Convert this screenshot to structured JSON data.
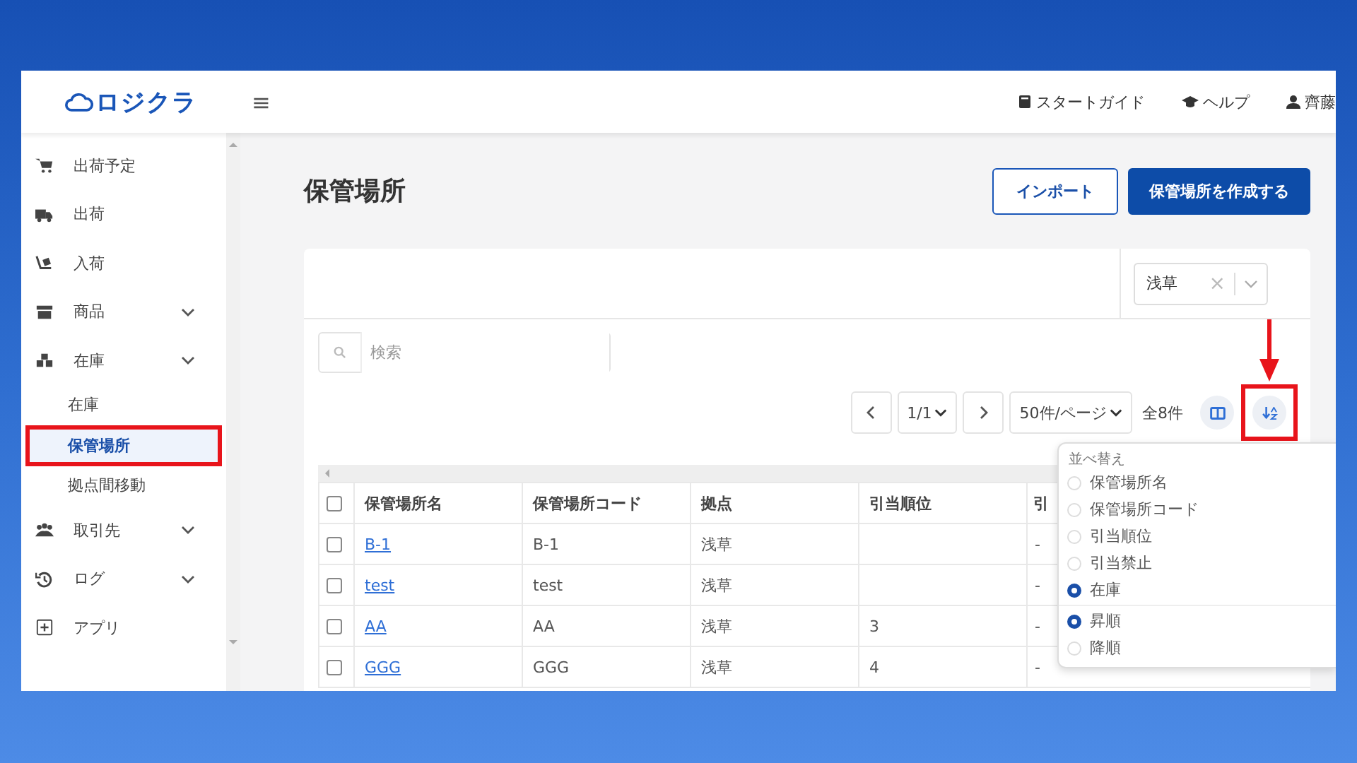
{
  "logo": {
    "text": "ロジクラ"
  },
  "header": {
    "menu_icon": "≡",
    "links": [
      {
        "kind": "book",
        "label": "スタートガイド"
      },
      {
        "kind": "cap",
        "label": "ヘルプ"
      },
      {
        "kind": "user",
        "label": "齊藤"
      }
    ]
  },
  "sidebar": {
    "items": [
      {
        "kind": "cart",
        "label": "出荷予定"
      },
      {
        "kind": "truck",
        "label": "出荷"
      },
      {
        "kind": "dolly",
        "label": "入荷"
      },
      {
        "kind": "box",
        "label": "商品",
        "collapsible": true
      },
      {
        "kind": "boxes",
        "label": "在庫",
        "collapsible": true,
        "children": [
          {
            "label": "在庫",
            "selected": false
          },
          {
            "label": "保管場所",
            "selected": true
          },
          {
            "label": "拠点間移動",
            "selected": false
          }
        ]
      },
      {
        "kind": "people",
        "label": "取引先",
        "collapsible": true
      },
      {
        "kind": "history",
        "label": "ログ",
        "collapsible": true
      },
      {
        "kind": "plus",
        "label": "アプリ"
      }
    ]
  },
  "page": {
    "title": "保管場所",
    "buttons": [
      {
        "kind": "outline",
        "label": "インポート"
      },
      {
        "kind": "primary",
        "label": "保管場所を作成する"
      }
    ]
  },
  "filter": {
    "value": "浅草",
    "clear_icon": "×"
  },
  "search": {
    "placeholder": "検索"
  },
  "pagination": {
    "page": "1/1",
    "per_page": "50件/ページ",
    "total": "全8件"
  },
  "table": {
    "select_all_checked": false,
    "columns": [
      "保管場所名",
      "保管場所コード",
      "拠点",
      "引当順位",
      "引"
    ],
    "rows": [
      {
        "checked": false,
        "name": "B-1",
        "code": "B-1",
        "base": "浅草",
        "column_5": "-"
      },
      {
        "checked": false,
        "name": "test",
        "code": "test",
        "base": "浅草",
        "column_5": "-"
      },
      {
        "checked": false,
        "name": "AA",
        "code": "AA",
        "base": "浅草",
        "priority": "3",
        "column_5": "-"
      },
      {
        "checked": false,
        "name": "GGG",
        "code": "GGG",
        "base": "浅草",
        "priority": "4",
        "column_5": "-"
      }
    ]
  },
  "sort_menu": {
    "title": "並べ替え",
    "fields": [
      {
        "label": "保管場所名",
        "selected": false
      },
      {
        "label": "保管場所コード",
        "selected": false
      },
      {
        "label": "引当順位",
        "selected": false
      },
      {
        "label": "引当禁止",
        "selected": false
      },
      {
        "label": "在庫",
        "selected": true
      }
    ],
    "orders": [
      {
        "label": "昇順",
        "selected": true
      },
      {
        "label": "降順",
        "selected": false
      }
    ]
  },
  "annotations": [
    {
      "kind": "nav_outline"
    },
    {
      "kind": "sort_outline"
    },
    {
      "kind": "arrow"
    }
  ]
}
